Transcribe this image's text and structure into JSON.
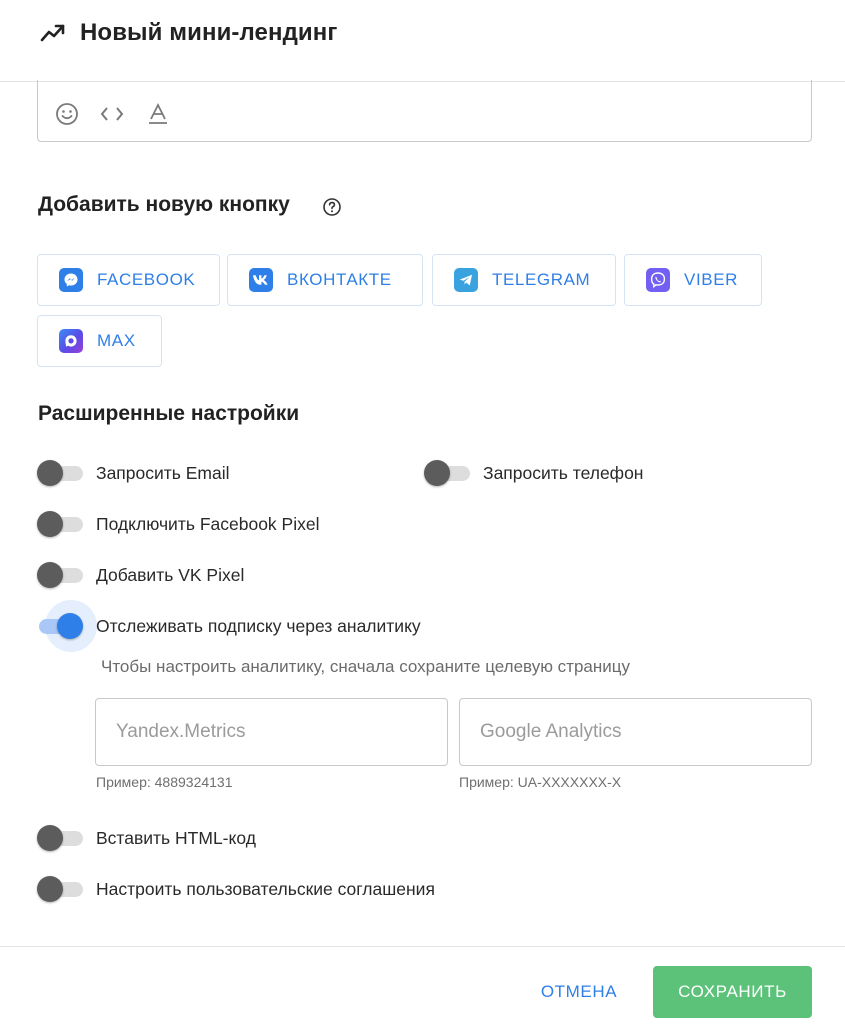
{
  "header": {
    "title": "Новый мини-лендинг",
    "icon": "trending-up-icon"
  },
  "editor": {
    "tools": [
      "emoji-icon",
      "code-icon",
      "text-format-icon"
    ]
  },
  "add_button_section": {
    "title": "Добавить новую кнопку",
    "help_icon": "help-circle-icon",
    "buttons": [
      {
        "label": "FACEBOOK",
        "icon": "messenger-icon",
        "color": "#2f7fe8"
      },
      {
        "label": "ВКОНТАКТЕ",
        "icon": "vk-icon",
        "color": "#2f7fe8"
      },
      {
        "label": "TELEGRAM",
        "icon": "telegram-icon",
        "color": "#3aa3df"
      },
      {
        "label": "VIBER",
        "icon": "viber-icon",
        "color": "#7360f2"
      },
      {
        "label": "MAX",
        "icon": "max-icon",
        "color": "#5b4be8"
      }
    ]
  },
  "advanced": {
    "title": "Расширенные настройки",
    "toggles": {
      "request_email": {
        "label": "Запросить Email",
        "on": false
      },
      "request_phone": {
        "label": "Запросить телефон",
        "on": false
      },
      "facebook_pixel": {
        "label": "Подключить Facebook Pixel",
        "on": false
      },
      "vk_pixel": {
        "label": "Добавить VK Pixel",
        "on": false
      },
      "analytics": {
        "label": "Отслеживать подписку через аналитику",
        "on": true
      },
      "html_code": {
        "label": "Вставить HTML-код",
        "on": false
      },
      "user_agreements": {
        "label": "Настроить пользовательские соглашения",
        "on": false
      }
    },
    "analytics_hint": "Чтобы настроить аналитику, сначала сохраните целевую страницу",
    "yandex": {
      "placeholder": "Yandex.Metrics",
      "value": "",
      "example": "Пример: 4889324131"
    },
    "google": {
      "placeholder": "Google Analytics",
      "value": "",
      "example": "Пример: UA-XXXXXXX-X"
    }
  },
  "footer": {
    "cancel_label": "ОТМЕНА",
    "save_label": "СОХРАНИТЬ"
  },
  "colors": {
    "accent": "#2f7fe8",
    "save": "#5cc27a",
    "toggle_off_knob": "#5c5c5c"
  }
}
